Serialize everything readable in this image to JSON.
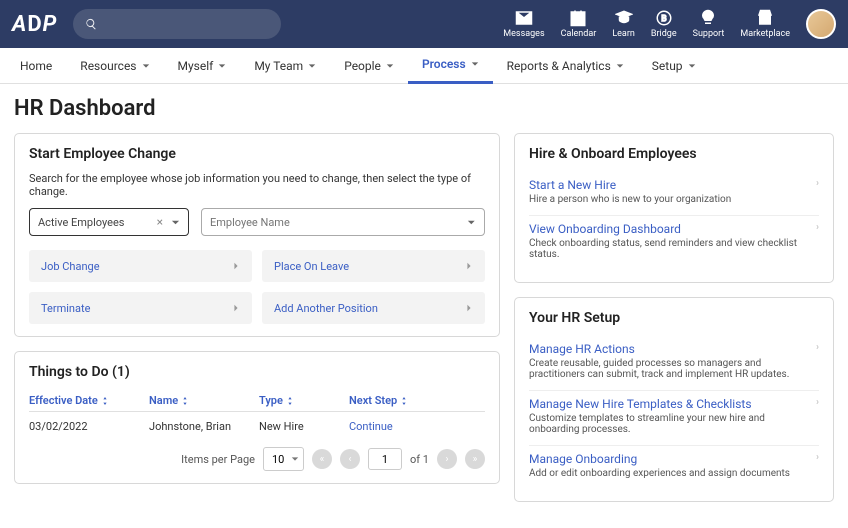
{
  "top_nav": [
    {
      "icon": "mail",
      "label": "Messages"
    },
    {
      "icon": "calendar",
      "label": "Calendar"
    },
    {
      "icon": "learn",
      "label": "Learn"
    },
    {
      "icon": "bridge",
      "label": "Bridge"
    },
    {
      "icon": "support",
      "label": "Support"
    },
    {
      "icon": "marketplace",
      "label": "Marketplace"
    }
  ],
  "menu": [
    {
      "label": "Home",
      "dropdown": false
    },
    {
      "label": "Resources",
      "dropdown": true
    },
    {
      "label": "Myself",
      "dropdown": true
    },
    {
      "label": "My Team",
      "dropdown": true
    },
    {
      "label": "People",
      "dropdown": true
    },
    {
      "label": "Process",
      "dropdown": true,
      "active": true
    },
    {
      "label": "Reports & Analytics",
      "dropdown": true
    },
    {
      "label": "Setup",
      "dropdown": true
    }
  ],
  "page_title": "HR Dashboard",
  "start_change": {
    "title": "Start Employee Change",
    "hint": "Search for the employee whose job information you need to change, then select the type of change.",
    "filter_value": "Active Employees",
    "name_placeholder": "Employee Name",
    "actions": [
      "Job Change",
      "Place On Leave",
      "Terminate",
      "Add Another Position"
    ]
  },
  "things": {
    "title": "Things to Do (1)",
    "columns": [
      "Effective Date",
      "Name",
      "Type",
      "Next Step"
    ],
    "rows": [
      {
        "date": "03/02/2022",
        "name": "Johnstone, Brian",
        "type": "New Hire",
        "next": "Continue"
      }
    ],
    "pager": {
      "label": "Items per Page",
      "size": "10",
      "page": "1",
      "of": "of 1"
    }
  },
  "hire": {
    "title": "Hire & Onboard Employees",
    "items": [
      {
        "title": "Start a New Hire",
        "desc": "Hire a person who is new to your organization"
      },
      {
        "title": "View Onboarding Dashboard",
        "desc": "Check onboarding status, send reminders and view checklist status."
      }
    ]
  },
  "setup": {
    "title": "Your HR Setup",
    "items": [
      {
        "title": "Manage HR Actions",
        "desc": "Create reusable, guided processes so managers and practitioners can submit, track and implement HR updates."
      },
      {
        "title": "Manage New Hire Templates & Checklists",
        "desc": "Customize templates to streamline your new hire and onboarding processes."
      },
      {
        "title": "Manage Onboarding",
        "desc": "Add or edit onboarding experiences and assign documents"
      }
    ]
  }
}
